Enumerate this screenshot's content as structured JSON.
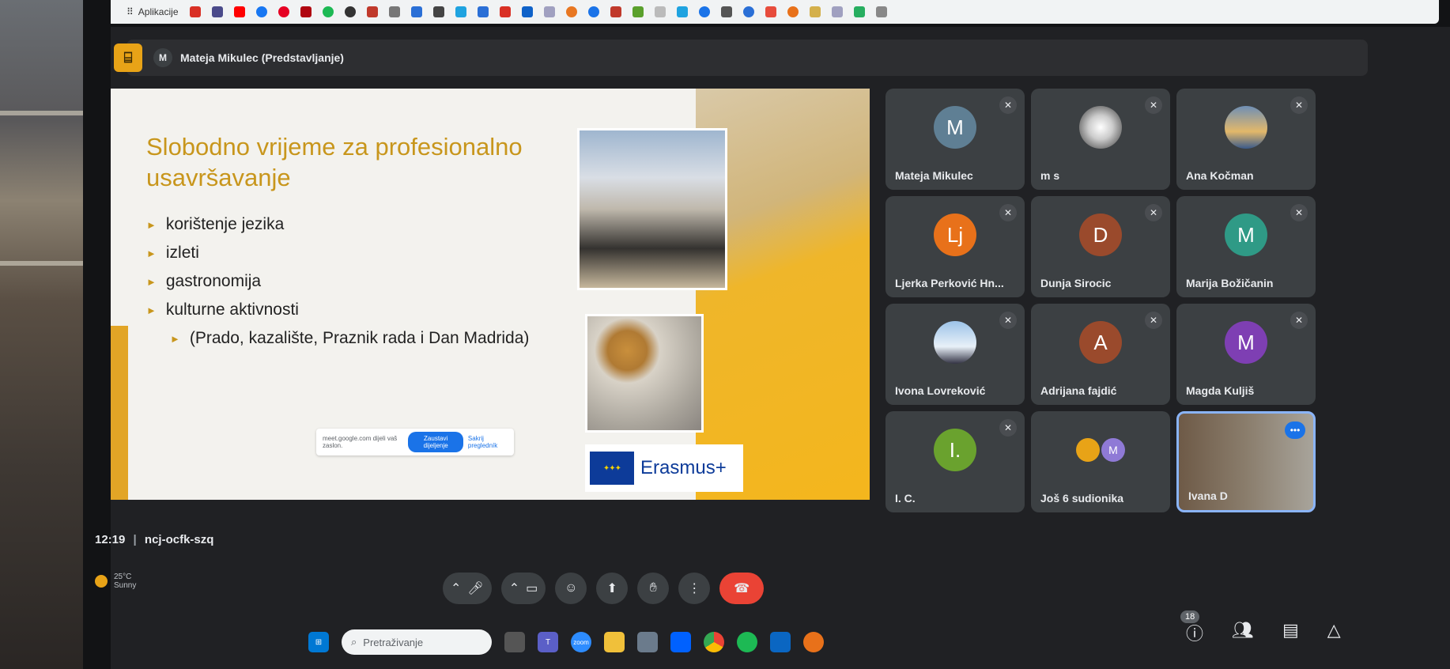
{
  "bookmarks": {
    "apps_label": "Aplikacije"
  },
  "topbar": {
    "presenter_initial": "M",
    "presenter_label": "Mateja Mikulec (Predstavljanje)"
  },
  "slide": {
    "title": "Slobodno vrijeme za profesionalno usavršavanje",
    "bullets": [
      "korištenje jezika",
      "izleti",
      "gastronomija",
      "kulturne aktivnosti"
    ],
    "sub_bullet": "(Prado, kazalište, Praznik rada i Dan Madrida)",
    "logo_text": "Erasmus+",
    "share_bar": {
      "text": "meet.google.com dijeli vaš zaslon.",
      "stop_label": "Zaustavi dijeljenje",
      "hide_label": "Sakrij pregledník"
    }
  },
  "participants": [
    {
      "initial": "M",
      "name": "Mateja Mikulec",
      "color": "#5f7f94"
    },
    {
      "initial": "",
      "name": "m s",
      "color": "#f1f1f1"
    },
    {
      "initial": "",
      "name": "Ana Kočman",
      "color": "#6f8fb5"
    },
    {
      "initial": "Lj",
      "name": "Ljerka Perković Hn...",
      "color": "#e8711a"
    },
    {
      "initial": "D",
      "name": "Dunja Sirocic",
      "color": "#9a4a2c"
    },
    {
      "initial": "M",
      "name": "Marija Božičanin",
      "color": "#2f9a86"
    },
    {
      "initial": "",
      "name": "Ivona Lovreković",
      "color": "#9cc3e8"
    },
    {
      "initial": "A",
      "name": "Adrijana fajdić",
      "color": "#9a4a2c"
    },
    {
      "initial": "M",
      "name": "Magda Kuljiš",
      "color": "#7e3fb3"
    },
    {
      "initial": "I.",
      "name": "I. C.",
      "color": "#6aa22e"
    },
    {
      "initial": "M",
      "name": "Još 6 sudionika",
      "color": "#8f7ad6"
    },
    {
      "initial": "",
      "name": "Ivana D",
      "color": "#000000"
    }
  ],
  "meeting": {
    "time": "12:19",
    "code": "ncj-ocfk-szq"
  },
  "weather": {
    "temp": "25°C",
    "cond": "Sunny"
  },
  "people_count": "18",
  "taskbar": {
    "search_placeholder": "Pretraživanje",
    "zoom_label": "zoom"
  }
}
